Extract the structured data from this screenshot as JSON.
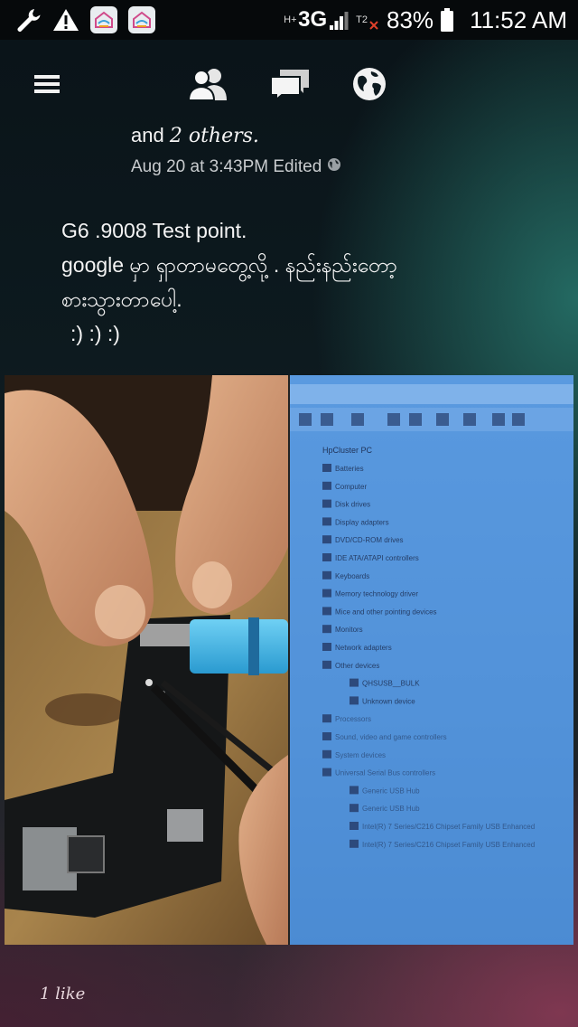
{
  "status_bar": {
    "icons": [
      "wrench-icon",
      "warning-icon",
      "app-icon",
      "app-icon"
    ],
    "network_h": "H+",
    "network_type": "3G",
    "sim2_label": "T2",
    "battery_percent": "83%",
    "time": "11:52 AM"
  },
  "nav": {
    "icons": [
      "menu-icon",
      "friends-icon",
      "messages-icon",
      "globe-icon"
    ]
  },
  "post": {
    "tagline_prefix": "and",
    "tagline_others": "2 others.",
    "timestamp": "Aug 20 at 3:43PM Edited",
    "body_lines": [
      "G6 .9008 Test point.",
      "google မှာ ရှာတာမတွေ့လို့ . နည်းနည်းတော့",
      "စားသွားတာပေါ့.",
      ":) :) :)"
    ],
    "likes": "1 like"
  },
  "photo": {
    "device_manager_root": "HpCluster PC",
    "device_manager_items": [
      "Batteries",
      "Computer",
      "Disk drives",
      "Display adapters",
      "DVD/CD-ROM drives",
      "IDE ATA/ATAPI controllers",
      "Keyboards",
      "Memory technology driver",
      "Mice and other pointing devices",
      "Monitors",
      "Network adapters",
      "Other devices",
      "QHSUSB__BULK",
      "Unknown device",
      "Processors",
      "Sound, video and game controllers",
      "System devices",
      "Universal Serial Bus controllers",
      "Generic USB Hub",
      "Generic USB Hub",
      "Intel(R) 7 Series/C216 Chipset Family USB Enhanced",
      "Intel(R) 7 Series/C216 Chipset Family USB Enhanced"
    ]
  },
  "colors": {
    "status_bar_bg": "#06090b",
    "text_primary": "#f4f4f4",
    "text_secondary": "#c9cccf",
    "screen_blue": "#4f8fd6"
  }
}
